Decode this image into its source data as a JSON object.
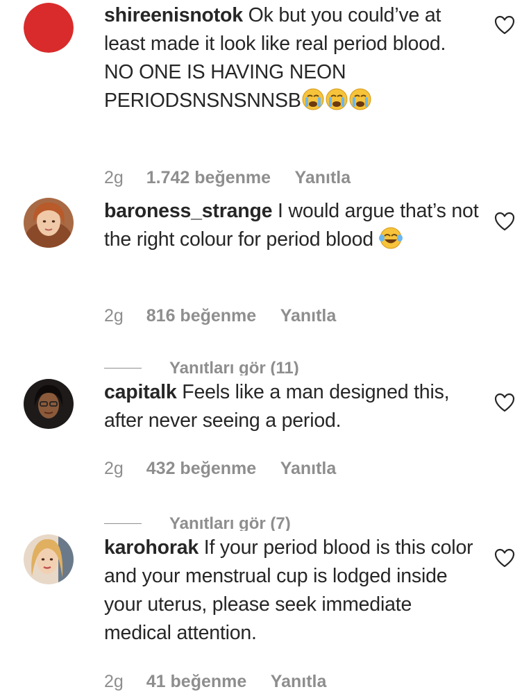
{
  "comments": [
    {
      "username": "shireenisnotok",
      "text": "Ok but you could’ve at least made it look like real period blood. NO ONE IS HAVING NEON PERIODSNSNSNNSB",
      "emoji": "😭😭😭",
      "age": "2g",
      "likes": "1.742 beğenme",
      "reply_label": "Yanıtla",
      "avatar_color": "#d92b2b"
    },
    {
      "username": "baroness_strange",
      "text": "I would argue that’s not the right colour for period blood",
      "emoji": "😂",
      "age": "2g",
      "likes": "816 beğenme",
      "reply_label": "Yanıtla",
      "replies_label": "Yanıtları gör (11)"
    },
    {
      "username": "capitalk",
      "text": "Feels like a man designed this, after never seeing a period.",
      "age": "2g",
      "likes": "432 beğenme",
      "reply_label": "Yanıtla",
      "replies_label": "Yanıtları gör (7)"
    },
    {
      "username": "karohorak",
      "text": "If your period blood is this color and your menstrual cup is lodged inside your uterus, please seek immediate medical attention.",
      "age": "2g",
      "likes": "41 beğenme",
      "reply_label": "Yanıtla"
    }
  ],
  "icons": {
    "like": "heart-outline-icon"
  }
}
